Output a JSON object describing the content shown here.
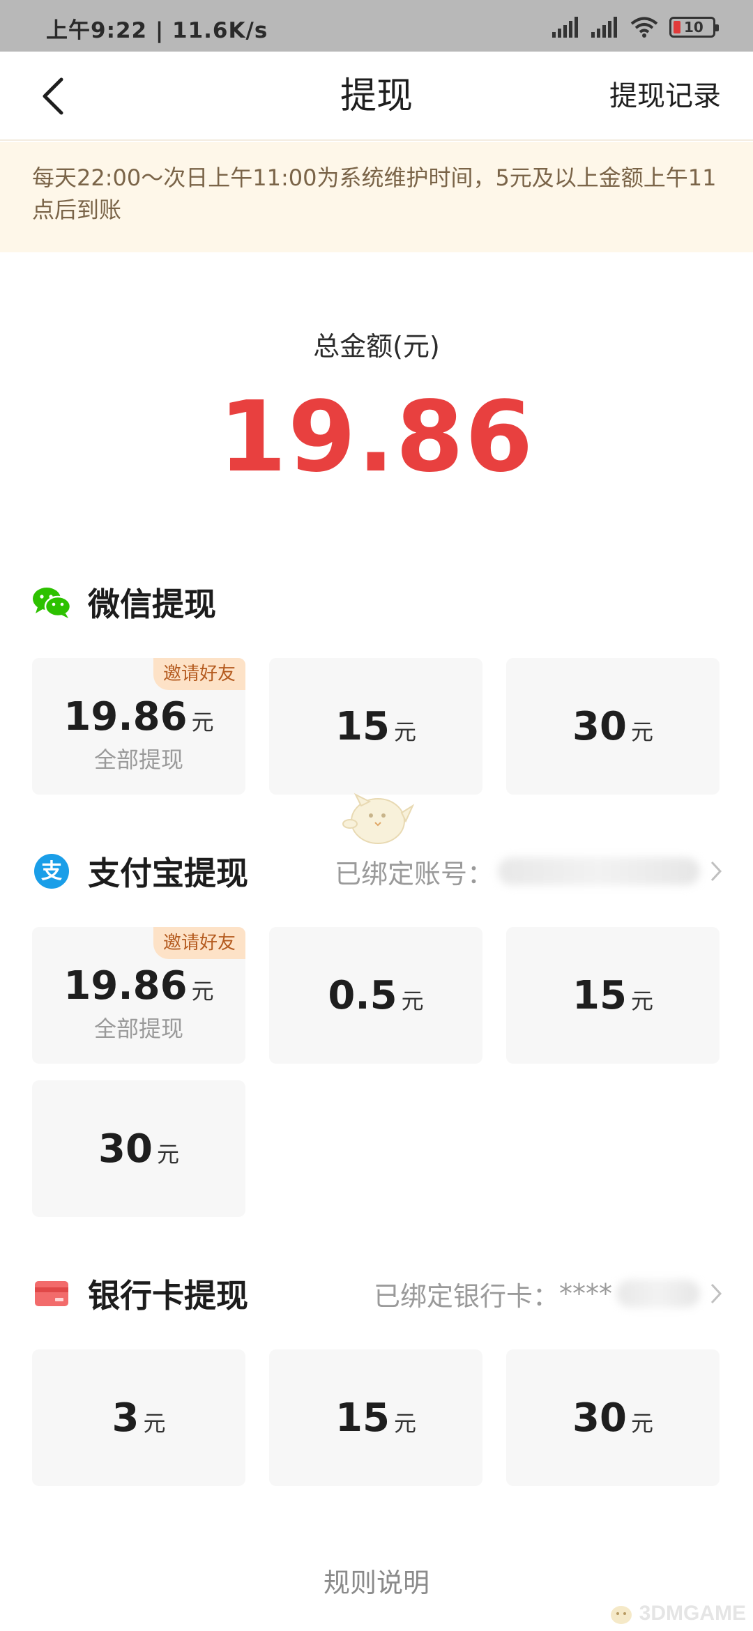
{
  "status_bar": {
    "time_speed": "上午9:22 | 11.6K/s",
    "battery": "10"
  },
  "nav": {
    "title": "提现",
    "record_label": "提现记录",
    "back_icon": "chevron-left-icon"
  },
  "notice": {
    "text": "每天22:00～次日上午11:00为系统维护时间，5元及以上金额上午11点后到账"
  },
  "total": {
    "label": "总金额(元)",
    "amount": "19.86",
    "color": "#e8403f"
  },
  "wechat": {
    "title": "微信提现",
    "icon": "wechat-icon",
    "options": [
      {
        "value": "19.86",
        "unit": "元",
        "sub": "全部提现",
        "badge": "邀请好友"
      },
      {
        "value": "15",
        "unit": "元"
      },
      {
        "value": "30",
        "unit": "元"
      }
    ]
  },
  "alipay": {
    "title": "支付宝提现",
    "icon": "alipay-icon",
    "bound_label": "已绑定账号：",
    "options": [
      {
        "value": "19.86",
        "unit": "元",
        "sub": "全部提现",
        "badge": "邀请好友"
      },
      {
        "value": "0.5",
        "unit": "元"
      },
      {
        "value": "15",
        "unit": "元"
      },
      {
        "value": "30",
        "unit": "元"
      }
    ]
  },
  "bank": {
    "title": "银行卡提现",
    "icon": "bank-card-icon",
    "bound_label": "已绑定银行卡：",
    "bound_mask": "****",
    "options": [
      {
        "value": "3",
        "unit": "元"
      },
      {
        "value": "15",
        "unit": "元"
      },
      {
        "value": "30",
        "unit": "元"
      }
    ]
  },
  "footer": {
    "rules_label": "规则说明",
    "watermark": "3DMGAME"
  }
}
